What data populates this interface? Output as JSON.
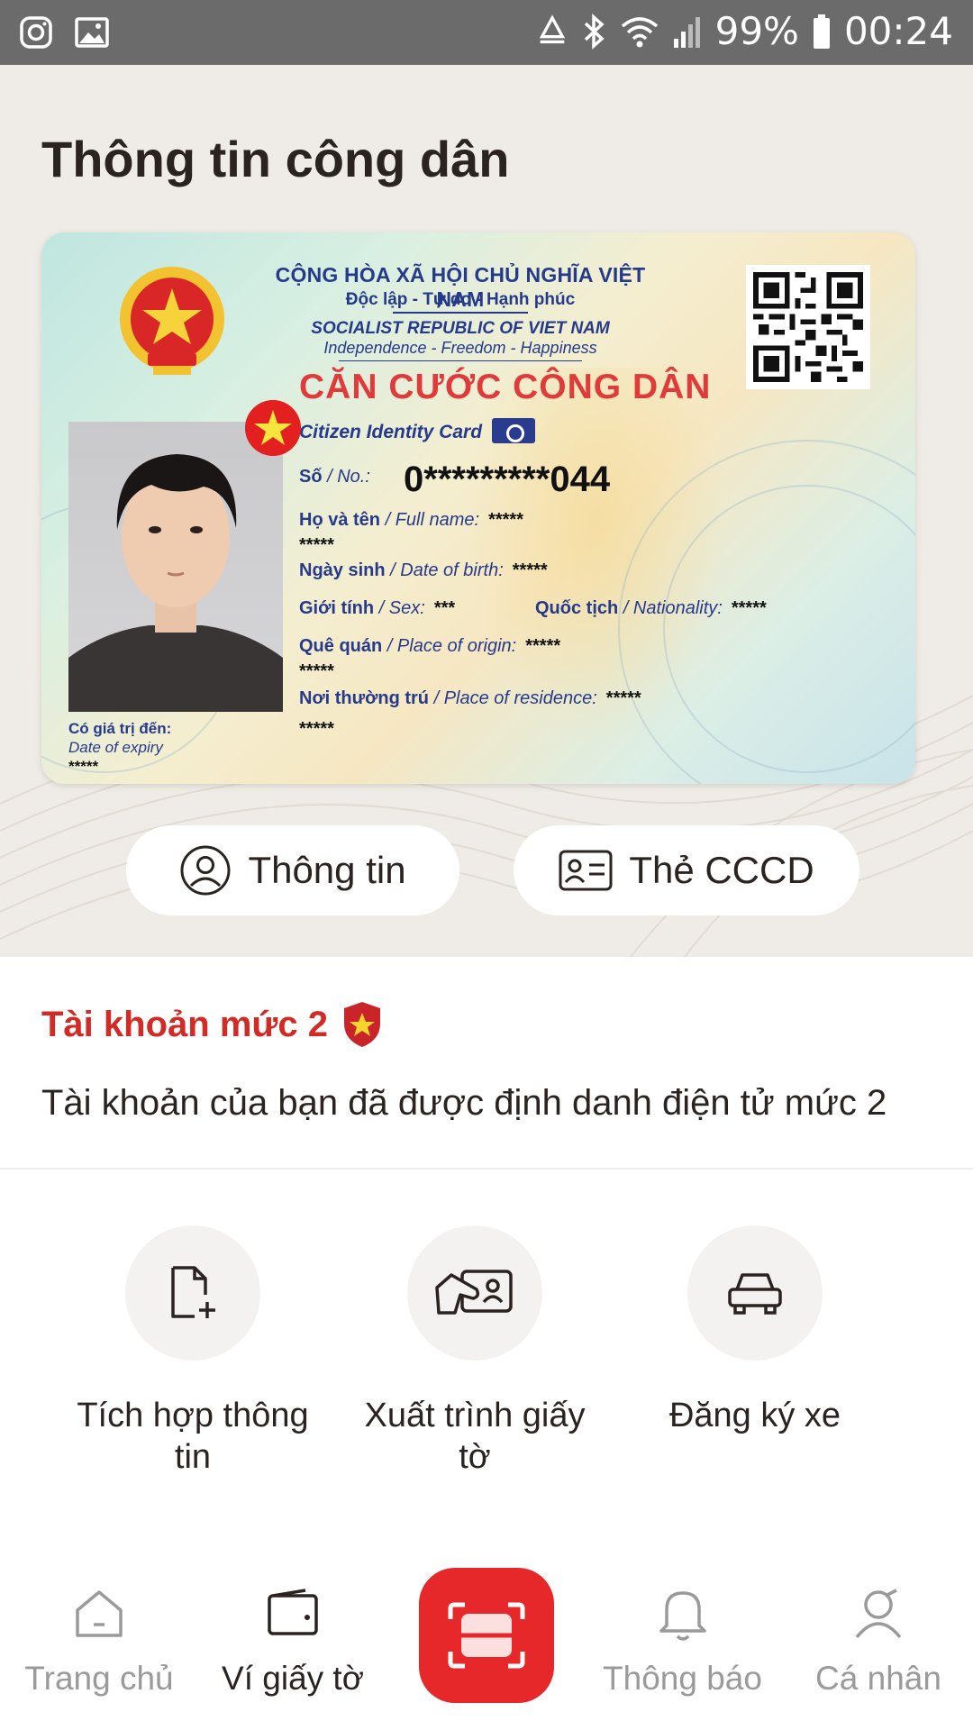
{
  "status_bar": {
    "battery": "99%",
    "time": "00:24",
    "icons": [
      "instagram-icon",
      "gallery-icon",
      "recycle-icon",
      "bluetooth-icon",
      "wifi-icon",
      "signal-icon",
      "battery-icon"
    ]
  },
  "page": {
    "title": "Thông tin công dân"
  },
  "id_card": {
    "header_line1": "CỘNG HÒA XÃ HỘI CHỦ NGHĨA VIỆT NAM",
    "header_line2": "Độc lập - Tự do - Hạnh phúc",
    "header_line3": "SOCIALIST REPUBLIC OF VIET NAM",
    "header_line4": "Independence - Freedom - Happiness",
    "title": "CĂN CƯỚC CÔNG DÂN",
    "subtitle": "Citizen Identity Card",
    "number_label_vi": "Số",
    "number_label_en": "/ No.:",
    "number_value": "0*********044",
    "name_label_vi": "Họ và tên",
    "name_label_en": "/ Full name:",
    "name_value": "*****",
    "name_value2": "*****",
    "dob_label_vi": "Ngày sinh",
    "dob_label_en": "/ Date of birth:",
    "dob_value": "*****",
    "sex_label_vi": "Giới tính",
    "sex_label_en": "/ Sex:",
    "sex_value": "***",
    "nationality_label_vi": "Quốc tịch",
    "nationality_label_en": "/ Nationality:",
    "nationality_value": "*****",
    "origin_label_vi": "Quê quán",
    "origin_label_en": "/ Place of origin:",
    "origin_value": "*****",
    "origin_value2": "*****",
    "residence_label_vi": "Nơi thường trú",
    "residence_label_en": "/ Place of residence:",
    "residence_value": "*****",
    "residence_value2": "*****",
    "expiry_label_vi": "Có giá trị đến:",
    "expiry_label_en": "Date of expiry",
    "expiry_value": "*****"
  },
  "actions": {
    "info_label": "Thông tin",
    "card_label": "Thẻ CCCD"
  },
  "account": {
    "level_title": "Tài khoản mức 2",
    "level_desc": "Tài khoản của bạn đã được định danh điện tử mức 2"
  },
  "features": [
    {
      "line1": "Tích hợp thông",
      "line2": "tin",
      "icon": "file-add-icon"
    },
    {
      "line1": "Xuất trình giấy",
      "line2": "tờ",
      "icon": "id-present-icon"
    },
    {
      "line1": "Đăng ký xe",
      "line2": "",
      "icon": "car-icon"
    }
  ],
  "bottom_nav": {
    "home": "Trang chủ",
    "wallet": "Ví giấy tờ",
    "notifications": "Thông báo",
    "profile": "Cá nhân"
  },
  "colors": {
    "accent_red": "#e6282b",
    "level_red": "#d42a25",
    "hero_bg": "#efebe6",
    "card_blue": "#263a8c"
  }
}
